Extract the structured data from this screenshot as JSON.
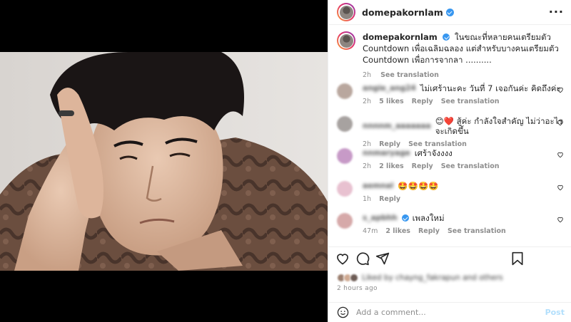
{
  "post": {
    "username": "domepakornlam",
    "caption": "ในขณะที่หลายคนเตรียมตัว Countdown เพื่อเฉลิมฉลอง แต่สำหรับบางคนเตรียมตัว Countdown เพื่อการจากลา ..........",
    "caption_time": "2h",
    "see_translation": "See translation",
    "posted_ago": "2 hours ago",
    "liked_by_text": "Liked by chayng_fakrapun and others"
  },
  "comments": [
    {
      "user": "angie_ang24",
      "text": "ไม่เศร้านะคะ วันที่ 7 เจอกันค่ะ คิดถึงค่ะ",
      "time": "2h",
      "likes": "5 likes",
      "reply": "Reply",
      "translate": "See translation",
      "avatar_color": "#b9a79e"
    },
    {
      "user": "nnnnm_aaaaaaa",
      "text": "😊❤️ สู้ค่ะ กำลังใจสำคัญ ไม่ว่าอะไรจะเกิดขึ้น",
      "time": "2h",
      "likes": "",
      "reply": "Reply",
      "translate": "See translation",
      "avatar_color": "#a7a2a0"
    },
    {
      "user": "nnmaryage",
      "text": "เศร้าจังงงง",
      "time": "2h",
      "likes": "2 likes",
      "reply": "Reply",
      "translate": "See translation",
      "avatar_color": "#c79ac7"
    },
    {
      "user": "aemnal",
      "text": "🤩🤩🤩🤩",
      "time": "1h",
      "likes": "",
      "reply": "Reply",
      "translate": "",
      "avatar_color": "#e8c1d0"
    },
    {
      "user": "s_apbhh",
      "text": "เพลงใหม่",
      "time": "47m",
      "likes": "2 likes",
      "reply": "Reply",
      "translate": "See translation",
      "avatar_color": "#d6a9a9",
      "verified": true
    }
  ],
  "add_comment": {
    "placeholder": "Add a comment...",
    "post_label": "Post"
  },
  "colors": {
    "accent": "#0095f6",
    "verified": "#3897f0",
    "muted": "#8e8e8e"
  },
  "icons": [
    "heart-icon",
    "comment-icon",
    "share-icon",
    "bookmark-icon",
    "more-icon",
    "emoji-icon"
  ]
}
